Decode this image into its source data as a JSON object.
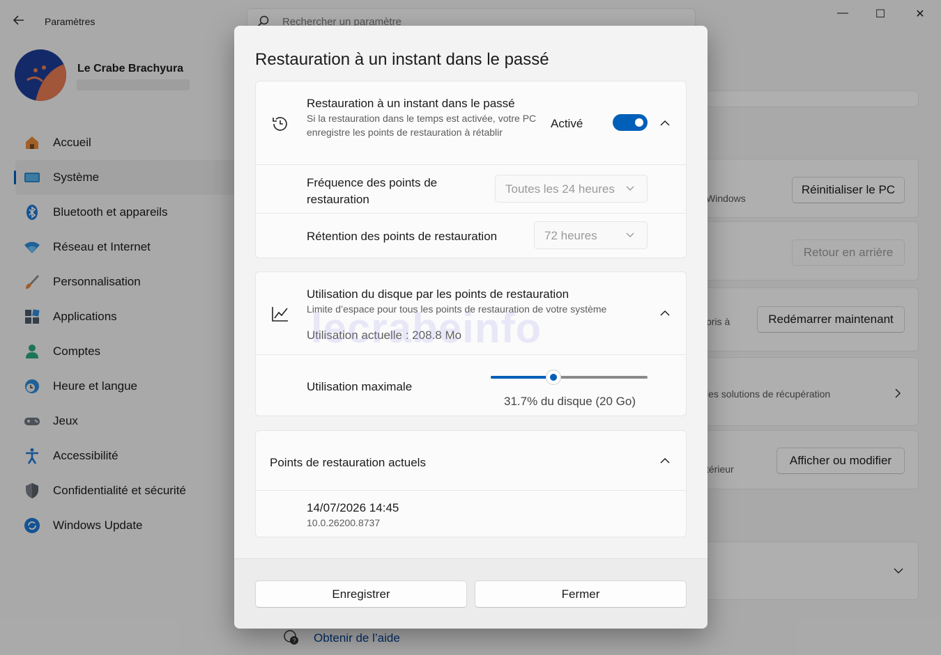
{
  "window": {
    "app_title": "Paramètres",
    "search_placeholder": "Rechercher un paramètre",
    "controls": {
      "minimize": "—",
      "maximize": "☐",
      "close": "✕"
    }
  },
  "user": {
    "name": "Le Crabe Brachyura"
  },
  "sidebar": {
    "items": [
      {
        "label": "Accueil",
        "icon": "home-icon"
      },
      {
        "label": "Système",
        "icon": "system-icon",
        "active": true
      },
      {
        "label": "Bluetooth et appareils",
        "icon": "bluetooth-icon"
      },
      {
        "label": "Réseau et Internet",
        "icon": "wifi-icon"
      },
      {
        "label": "Personnalisation",
        "icon": "brush-icon"
      },
      {
        "label": "Applications",
        "icon": "apps-icon"
      },
      {
        "label": "Comptes",
        "icon": "account-icon"
      },
      {
        "label": "Heure et langue",
        "icon": "clock-globe-icon"
      },
      {
        "label": "Jeux",
        "icon": "gamepad-icon"
      },
      {
        "label": "Accessibilité",
        "icon": "accessibility-icon"
      },
      {
        "label": "Confidentialité et sécurité",
        "icon": "shield-icon"
      },
      {
        "label": "Windows Update",
        "icon": "update-icon"
      }
    ]
  },
  "background": {
    "reset_button": "Réinitialiser le PC",
    "reset_text": "Windows",
    "go_back_button": "Retour en arrière",
    "restart_text": "pris à",
    "restart_button": "Redémarrer maintenant",
    "recovery_text": "les solutions de récupération",
    "external_text": "térieur",
    "view_button": "Afficher ou modifier",
    "help_link": "Obtenir de l’aide"
  },
  "dialog": {
    "title": "Restauration à un instant dans le passé",
    "restore_section": {
      "title": "Restauration à un instant dans le passé",
      "description": "Si la restauration dans le temps est activée, votre PC enregistre les points de restauration à rétablir",
      "status": "Activé",
      "toggle_on": true,
      "frequency_label": "Fréquence des points de restauration",
      "frequency_value": "Toutes les 24 heures",
      "retention_label": "Rétention des points de restauration",
      "retention_value": "72 heures"
    },
    "disk_section": {
      "title": "Utilisation du disque par les points de restauration",
      "description": "Limite d’espace pour tous les points de restauration de votre système",
      "current_usage": "Utilisation actuelle : 208.8 Mo",
      "max_label": "Utilisation maximale",
      "max_value": "31.7% du disque (20 Go)",
      "slider_fraction": 0.4
    },
    "points_section": {
      "title": "Points de restauration actuels",
      "points": [
        {
          "date": "14/07/2026 14:45",
          "version": "10.0.26200.8737"
        }
      ]
    },
    "buttons": {
      "save": "Enregistrer",
      "close": "Fermer"
    },
    "watermark": "lecrabeinfo"
  },
  "colors": {
    "accent": "#005fb8",
    "link": "#003e92"
  }
}
